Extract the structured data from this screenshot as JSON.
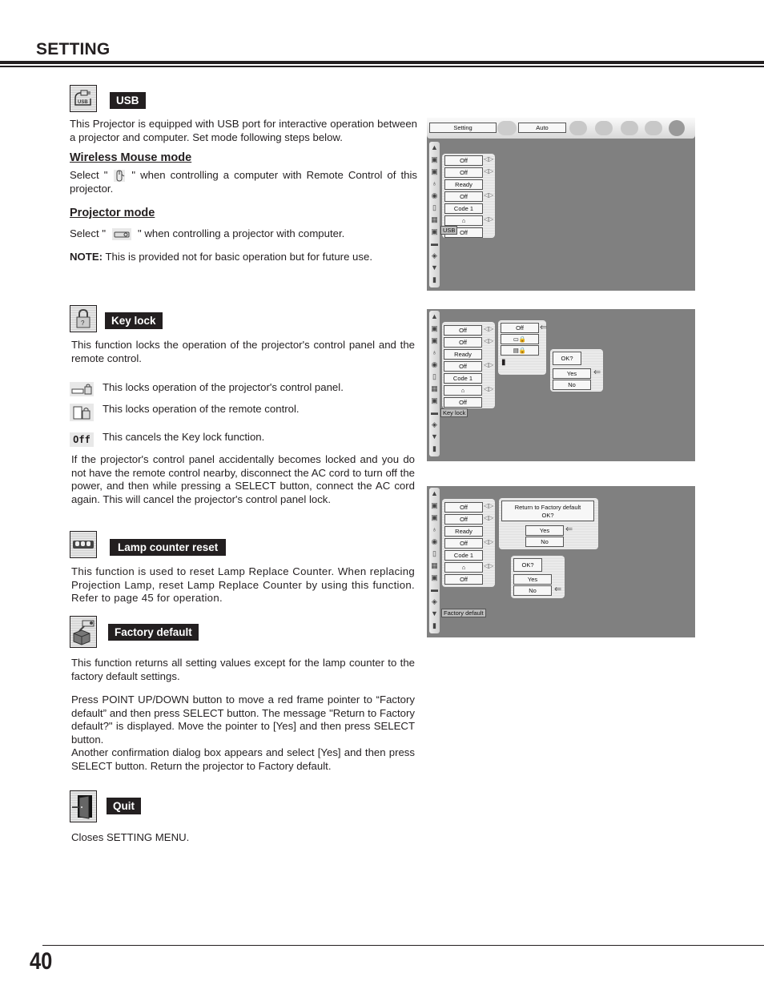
{
  "header": {
    "title": "SETTING"
  },
  "footer": {
    "page_number": "40"
  },
  "usb": {
    "label": "USB",
    "icon": "usb-icon",
    "intro": "This Projector is equipped with USB port for interactive operation between a projector and computer. Set mode following steps below.",
    "wireless_heading": "Wireless Mouse mode",
    "wireless_pre": "Select \"",
    "wireless_post": "\" when controlling a computer with Remote Control of this projector.",
    "projector_heading": "Projector mode",
    "projector_pre": "Select \"",
    "projector_post": "\" when controlling a projector with computer.",
    "note_label": "NOTE:",
    "note_text": " This is provided not for basic operation but for future use."
  },
  "keylock": {
    "label": "Key lock",
    "icon": "padlock-icon",
    "intro": "This function locks the operation of the projector's control panel and the remote control.",
    "opt1": "This locks operation of the projector's control panel.",
    "opt2": "This locks operation of the remote control.",
    "opt3_icon_text": "Off",
    "opt3": "This cancels the Key lock function.",
    "warning": "If the projector's control panel accidentally becomes locked and you do not have the remote control nearby, disconnect the AC cord to turn off the power, and then while pressing a SELECT button, connect the AC cord again. This will cancel the projector's control panel lock."
  },
  "lamp": {
    "label": "Lamp counter reset",
    "icon": "lamp-counter-icon",
    "text": "This function is used to reset Lamp Replace Counter.  When replacing Projection Lamp, reset Lamp Replace Counter by using this function.  Refer to page 45 for operation."
  },
  "factory": {
    "label": "Factory default",
    "icon": "factory-default-icon",
    "text1": "This function returns all setting values except for the lamp counter to the factory default settings.",
    "text2": "Press POINT UP/DOWN button to move a red frame pointer to “Factory default” and then press SELECT button.  The message \"Return to Factory default?\" is displayed.  Move the pointer to [Yes] and then press SELECT button.",
    "text3": "Another confirmation dialog box appears and select [Yes] and then press SELECT button. Return the projector to Factory default."
  },
  "quit": {
    "label": "Quit",
    "icon": "exit-door-icon",
    "text": "Closes SETTING MENU."
  },
  "osd1": {
    "top_menu": "Setting",
    "top_mode": "Auto",
    "fields": [
      "Off",
      "Off",
      "Ready",
      "Off",
      "Code 1",
      "mouse",
      "Off"
    ],
    "tooltip": "USB"
  },
  "osd2": {
    "fields": [
      "Off",
      "Off",
      "Ready",
      "Off",
      "Code 1",
      "mouse",
      "Off"
    ],
    "tooltip": "Key lock",
    "submenu": [
      "Off",
      "panel-lock",
      "remote-lock"
    ],
    "confirm": {
      "question": "OK?",
      "yes": "Yes",
      "no": "No"
    }
  },
  "osd3": {
    "fields": [
      "Off",
      "Off",
      "Ready",
      "Off",
      "Code 1",
      "mouse",
      "Off"
    ],
    "tooltip": "Factory default",
    "dialog1": {
      "message": "Return to Factory default\nOK?",
      "yes": "Yes",
      "no": "No"
    },
    "dialog2": {
      "question": "OK?",
      "yes": "Yes",
      "no": "No"
    }
  }
}
